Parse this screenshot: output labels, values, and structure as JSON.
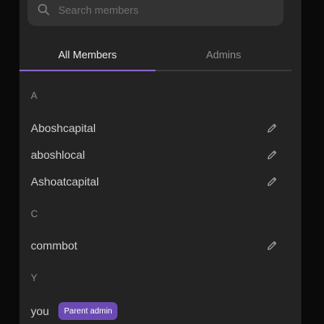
{
  "search": {
    "placeholder": "Search members",
    "value": ""
  },
  "tabs": [
    {
      "label": "All Members",
      "active": true
    },
    {
      "label": "Admins",
      "active": false
    }
  ],
  "sections": [
    {
      "header": "A",
      "members": [
        {
          "name": "Aboshcapital",
          "editable": true
        },
        {
          "name": "aboshlocal",
          "editable": true
        },
        {
          "name": "Ashoatcapital",
          "editable": true
        }
      ]
    },
    {
      "header": "C",
      "members": [
        {
          "name": "commbot",
          "editable": true
        }
      ]
    },
    {
      "header": "Y",
      "members": [
        {
          "name": "you",
          "editable": false,
          "badge": "Parent admin"
        }
      ]
    }
  ],
  "colors": {
    "accent": "#8a62c7",
    "badge_bg": "#6b4bb3",
    "panel_bg": "#232323"
  },
  "icons": [
    "search-icon",
    "pencil-icon"
  ]
}
